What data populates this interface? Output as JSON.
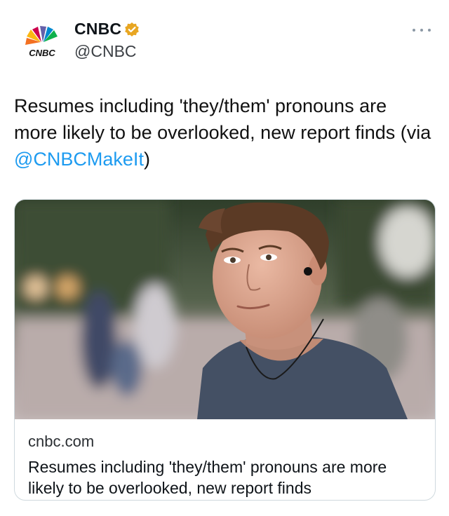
{
  "author": {
    "display_name": "CNBC",
    "handle": "@CNBC",
    "logo_text": "CNBC",
    "verified": true
  },
  "tweet": {
    "text_before": "Resumes including 'they/them' pronouns are more likely to be overlooked, new report finds (via ",
    "mention": "@CNBCMakeIt",
    "text_after": ")"
  },
  "card": {
    "domain": "cnbc.com",
    "title": "Resumes including 'they/them' pronouns are more likely to be overlooked, new report finds"
  },
  "colors": {
    "accent": "#1d9bf0",
    "verified_gold": "#e8a622",
    "text": "#0f1419",
    "border": "#cfd9de"
  },
  "icons": {
    "avatar": "cnbc-peacock-logo",
    "verified": "verified-badge-icon",
    "more": "more-options-icon"
  }
}
